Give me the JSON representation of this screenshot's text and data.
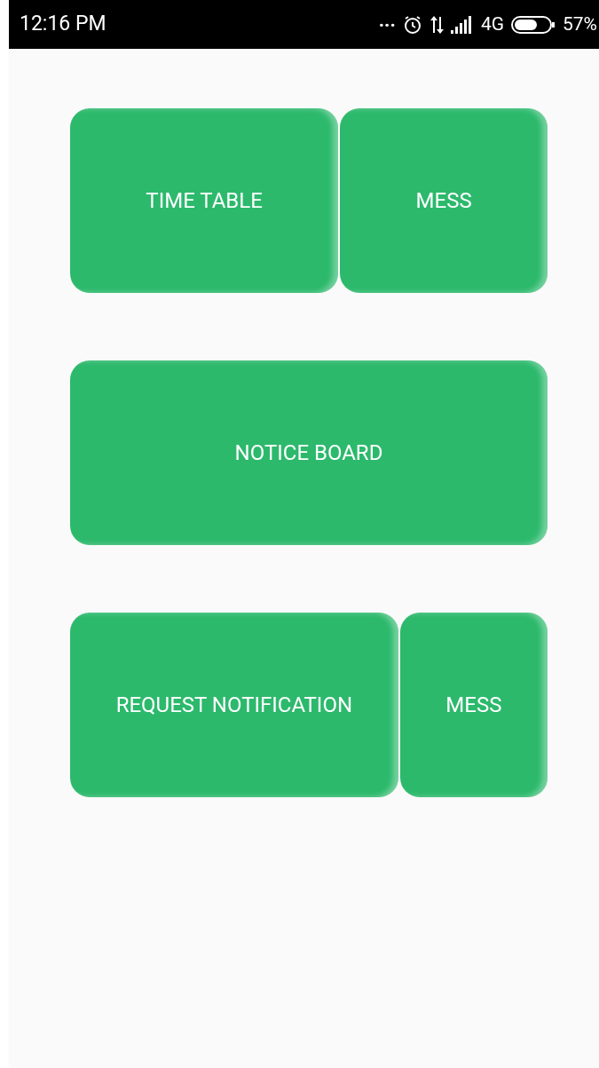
{
  "status_bar": {
    "time": "12:16 PM",
    "more": "...",
    "network": "4G",
    "battery": "57%"
  },
  "rows": [
    {
      "buttons": [
        {
          "label": "TIME TABLE"
        },
        {
          "label": "MESS"
        }
      ]
    },
    {
      "buttons": [
        {
          "label": "NOTICE BOARD"
        }
      ]
    },
    {
      "buttons": [
        {
          "label": "REQUEST NOTIFICATION"
        },
        {
          "label": "MESS"
        }
      ]
    }
  ]
}
